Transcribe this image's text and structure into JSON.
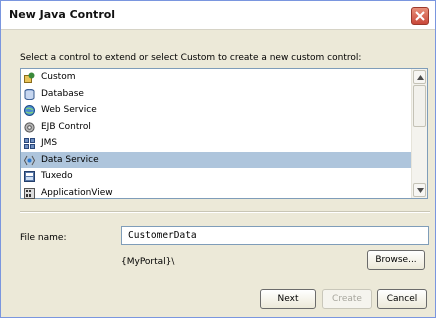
{
  "window": {
    "title": "New Java Control"
  },
  "instruction": "Select a control to extend or select Custom to create a new custom control:",
  "controls": [
    {
      "label": "Custom",
      "icon": "custom-control-icon",
      "selected": false
    },
    {
      "label": "Database",
      "icon": "database-icon",
      "selected": false
    },
    {
      "label": "Web Service",
      "icon": "web-service-icon",
      "selected": false
    },
    {
      "label": "EJB Control",
      "icon": "ejb-icon",
      "selected": false
    },
    {
      "label": "JMS",
      "icon": "jms-icon",
      "selected": false
    },
    {
      "label": "Data Service",
      "icon": "data-service-icon",
      "selected": true
    },
    {
      "label": "Tuxedo",
      "icon": "tuxedo-icon",
      "selected": false
    },
    {
      "label": "ApplicationView",
      "icon": "application-view-icon",
      "selected": false
    }
  ],
  "file": {
    "label": "File name:",
    "value": "CustomerData",
    "path": "{MyPortal}\\"
  },
  "buttons": {
    "browse": "Browse...",
    "next": "Next",
    "create": "Create",
    "cancel": "Cancel"
  },
  "colors": {
    "selection": "#aec5dc",
    "close": "#c9483a",
    "dialog_bg": "#ece9d8"
  }
}
